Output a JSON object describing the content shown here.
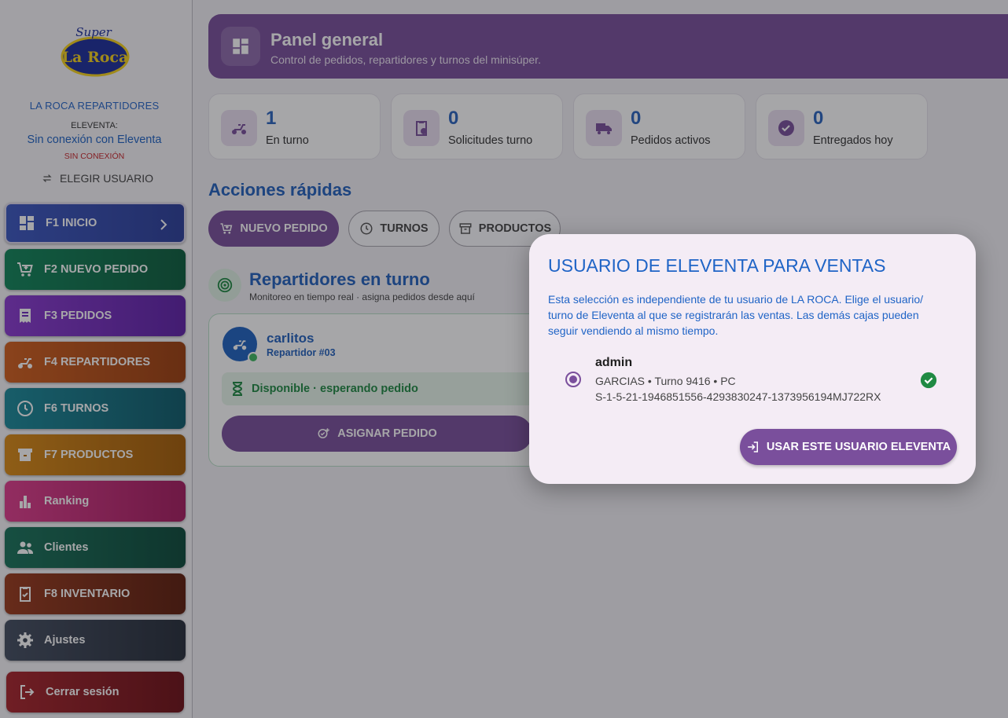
{
  "sidebar": {
    "logo_text": {
      "line1": "Super",
      "line2": "La Roca"
    },
    "brand": "LA ROCA REPARTIDORES",
    "eleventa_label": "ELEVENTA:",
    "eleventa_status": "Sin conexión con Eleventa",
    "eleventa_connection": "SIN CONEXIÓN",
    "choose_user": "ELEGIR USUARIO",
    "nav": [
      {
        "label": "F1 INICIO",
        "icon": "dashboard-icon",
        "color": "#3d55b7"
      },
      {
        "label": "F2 NUEVO PEDIDO",
        "icon": "cart-add-icon",
        "color": "#137a47"
      },
      {
        "label": "F3 PEDIDOS",
        "icon": "receipt-icon",
        "color": "#7a2fc0"
      },
      {
        "label": "F4 REPARTIDORES",
        "icon": "moped-icon",
        "color": "#c2571a"
      },
      {
        "label": "F6 TURNOS",
        "icon": "clock-icon",
        "color": "#177c8c"
      },
      {
        "label": "F7 PRODUCTOS",
        "icon": "archive-icon",
        "color": "#cf7d12"
      },
      {
        "label": "Ranking",
        "icon": "bar-chart-icon",
        "color": "#cf2f7e"
      },
      {
        "label": "Clientes",
        "icon": "people-icon",
        "color": "#17634f"
      },
      {
        "label": "F8 INVENTARIO",
        "icon": "clipboard-check-icon",
        "color": "#8a3318"
      },
      {
        "label": "Ajustes",
        "icon": "gear-icon",
        "color": "#3a4352"
      },
      {
        "label": "Cerrar sesión",
        "icon": "logout-icon",
        "color": "#9a1d23"
      }
    ]
  },
  "header": {
    "title": "Panel general",
    "subtitle": "Control de pedidos, repartidores y turnos del minisúper."
  },
  "stats": [
    {
      "value": "1",
      "label": "En turno",
      "icon": "moped-icon"
    },
    {
      "value": "0",
      "label": "Solicitudes turno",
      "icon": "clipboard-clock-icon"
    },
    {
      "value": "0",
      "label": "Pedidos activos",
      "icon": "truck-icon"
    },
    {
      "value": "0",
      "label": "Entregados hoy",
      "icon": "check-circle-icon"
    }
  ],
  "quick_actions": {
    "title": "Acciones rápidas",
    "buttons": [
      {
        "label": "NUEVO PEDIDO",
        "icon": "cart-add-icon"
      },
      {
        "label": "TURNOS",
        "icon": "clock-icon"
      },
      {
        "label": "PRODUCTOS",
        "icon": "archive-icon"
      }
    ]
  },
  "repartidores": {
    "title": "Repartidores en turno",
    "subtitle": "Monitoreo en tiempo real · asigna pedidos desde aquí",
    "card": {
      "name": "carlitos",
      "role": "Repartidor #03",
      "status": "Disponible · esperando pedido",
      "assign_label": "ASIGNAR PEDIDO"
    }
  },
  "modal": {
    "title": "USUARIO DE ELEVENTA PARA VENTAS",
    "description": "Esta selección es independiente de tu usuario de LA ROCA. Elige el usuario/ turno de Eleventa al que se registrarán las ventas. Las demás cajas pueden seguir vendiendo al mismo tiempo.",
    "option": {
      "name": "admin",
      "detail": "GARCIAS • Turno 9416 • PC",
      "id": "S-1-5-21-1946851556-4293830247-1373956194MJ722RX"
    },
    "use_button": "USAR ESTE USUARIO ELEVENTA"
  }
}
